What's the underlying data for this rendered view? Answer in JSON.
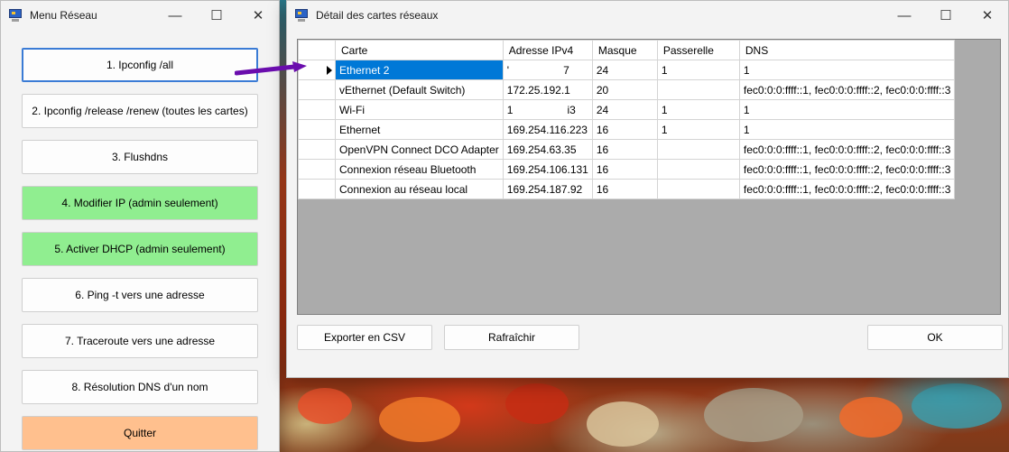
{
  "menu_window": {
    "title": "Menu Réseau",
    "controls": {
      "minimize": "—",
      "maximize": "☐",
      "close": "✕"
    },
    "buttons": [
      {
        "label": "1. Ipconfig /all",
        "color": "#fdfdfd"
      },
      {
        "label": "2. Ipconfig /release /renew (toutes les cartes)",
        "color": "#fdfdfd"
      },
      {
        "label": "3. Flushdns",
        "color": "#fdfdfd"
      },
      {
        "label": "4. Modifier IP (admin seulement)",
        "color": "#90ee90"
      },
      {
        "label": "5. Activer DHCP (admin seulement)",
        "color": "#90ee90"
      },
      {
        "label": "6. Ping -t vers une adresse",
        "color": "#fdfdfd"
      },
      {
        "label": "7. Traceroute vers une adresse",
        "color": "#fdfdfd"
      },
      {
        "label": "8. Résolution DNS d'un nom",
        "color": "#fdfdfd"
      },
      {
        "label": "Quitter",
        "color": "#ffc08e"
      }
    ]
  },
  "details_window": {
    "title": "Détail des cartes réseaux",
    "controls": {
      "minimize": "—",
      "maximize": "☐",
      "close": "✕"
    },
    "grid": {
      "columns": [
        "Carte",
        "Adresse IPv4",
        "Masque",
        "Passerelle",
        "DNS"
      ],
      "rows": [
        [
          "Ethernet 2",
          "'                  7",
          "24",
          "1",
          "1"
        ],
        [
          "vEthernet (Default Switch)",
          "172.25.192.1",
          "20",
          "",
          "fec0:0:0:ffff::1, fec0:0:0:ffff::2, fec0:0:0:ffff::3"
        ],
        [
          "Wi-Fi",
          "1                  i3",
          "24",
          "1",
          "1"
        ],
        [
          "Ethernet",
          "169.254.116.223",
          "16",
          "1",
          "1"
        ],
        [
          "OpenVPN Connect DCO Adapter",
          "169.254.63.35",
          "16",
          "",
          "fec0:0:0:ffff::1, fec0:0:0:ffff::2, fec0:0:0:ffff::3"
        ],
        [
          "Connexion réseau Bluetooth",
          "169.254.106.131",
          "16",
          "",
          "fec0:0:0:ffff::1, fec0:0:0:ffff::2, fec0:0:0:ffff::3"
        ],
        [
          "Connexion au réseau local",
          "169.254.187.92",
          "16",
          "",
          "fec0:0:0:ffff::1, fec0:0:0:ffff::2, fec0:0:0:ffff::3"
        ]
      ],
      "selected_row": 0
    },
    "buttons": {
      "export": "Exporter en CSV",
      "refresh": "Rafraîchir",
      "ok": "OK"
    }
  },
  "colors": {
    "selection": "#0078d7",
    "annotation_arrow": "#6a0dad",
    "grid_background": "#ababab"
  }
}
